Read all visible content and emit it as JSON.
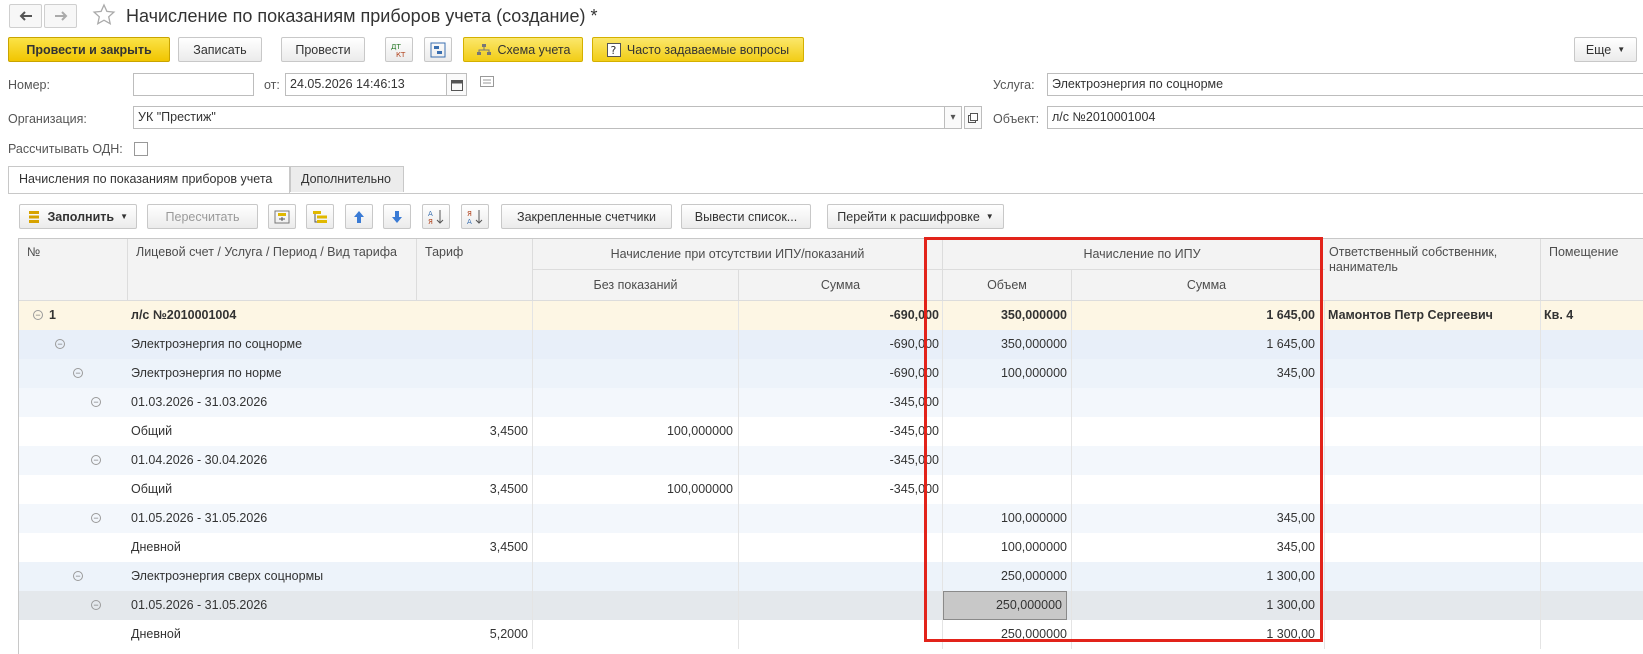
{
  "window": {
    "title": "Начисление по показаниям приборов учета (создание) *"
  },
  "toolbar": {
    "post_close": "Провести и закрыть",
    "save": "Записать",
    "post": "Провести",
    "dt_kt_icon": "dt-kt-icon",
    "structure_icon": "structure-icon",
    "schema": "Схема учета",
    "faq": "Часто задаваемые вопросы",
    "more": "Еще"
  },
  "header": {
    "number_label": "Номер:",
    "number_value": "",
    "date_label": "от:",
    "date_value": "24.05.2026 14:46:13",
    "org_label": "Организация:",
    "org_value": "УК \"Престиж\"",
    "odn_label": "Рассчитывать ОДН:",
    "odn_checked": false,
    "service_label": "Услуга:",
    "service_value": "Электроэнергия по соцнорме",
    "object_label": "Объект:",
    "object_value": "л/с №2010001004"
  },
  "tabs": [
    {
      "label": "Начисления по показаниям приборов учета",
      "active": true
    },
    {
      "label": "Дополнительно",
      "active": false
    }
  ],
  "table_toolbar": {
    "fill": "Заполнить",
    "recalc": "Пересчитать",
    "attached_meters": "Закрепленные счетчики",
    "export_list": "Вывести список...",
    "go_detail": "Перейти к расшифровке"
  },
  "table": {
    "headers": {
      "num": "№",
      "account": "Лицевой счет / Услуга / Период / Вид тарифа",
      "tariff": "Тариф",
      "no_ipu_group": "Начисление при отсутствии ИПУ/показаний",
      "no_readings": "Без показаний",
      "sum1": "Сумма",
      "ipu_group": "Начисление по ИПУ",
      "volume": "Объем",
      "sum2": "Сумма",
      "owner": "Ответственный собственник, наниматель",
      "premises": "Помещение"
    },
    "rows": [
      {
        "num": "1",
        "account": "л/с №2010001004",
        "level": 0,
        "tariff": "",
        "no_readings": "",
        "sum1": "-690,000",
        "volume": "350,000000",
        "sum2": "1 645,00",
        "owner": "Мамонтов Петр Сергеевич",
        "premises": "Кв. 4",
        "bold": true,
        "bg": "#fdf6e4",
        "tree": true
      },
      {
        "num": "",
        "account": "Электроэнергия по соцнорме",
        "level": 1,
        "tariff": "",
        "no_readings": "",
        "sum1": "-690,000",
        "volume": "350,000000",
        "sum2": "1 645,00",
        "owner": "",
        "premises": "",
        "bold": false,
        "bg": "#e8eff9",
        "tree": true
      },
      {
        "num": "",
        "account": "Электроэнергия по норме",
        "level": 2,
        "tariff": "",
        "no_readings": "",
        "sum1": "-690,000",
        "volume": "100,000000",
        "sum2": "345,00",
        "owner": "",
        "premises": "",
        "bold": false,
        "bg": "#edf3fa",
        "tree": true
      },
      {
        "num": "",
        "account": "01.03.2026 - 31.03.2026",
        "level": 3,
        "tariff": "",
        "no_readings": "",
        "sum1": "-345,000",
        "volume": "",
        "sum2": "",
        "owner": "",
        "premises": "",
        "bold": false,
        "bg": "#f3f7fc",
        "tree": true
      },
      {
        "num": "",
        "account": "Общий",
        "level": 3,
        "tariff": "3,4500",
        "no_readings": "100,000000",
        "sum1": "-345,000",
        "volume": "",
        "sum2": "",
        "owner": "",
        "premises": "",
        "bold": false,
        "bg": "#ffffff",
        "tree": false
      },
      {
        "num": "",
        "account": "01.04.2026 - 30.04.2026",
        "level": 3,
        "tariff": "",
        "no_readings": "",
        "sum1": "-345,000",
        "volume": "",
        "sum2": "",
        "owner": "",
        "premises": "",
        "bold": false,
        "bg": "#f3f7fc",
        "tree": true
      },
      {
        "num": "",
        "account": "Общий",
        "level": 3,
        "tariff": "3,4500",
        "no_readings": "100,000000",
        "sum1": "-345,000",
        "volume": "",
        "sum2": "",
        "owner": "",
        "premises": "",
        "bold": false,
        "bg": "#ffffff",
        "tree": false
      },
      {
        "num": "",
        "account": "01.05.2026 - 31.05.2026",
        "level": 3,
        "tariff": "",
        "no_readings": "",
        "sum1": "",
        "volume": "100,000000",
        "sum2": "345,00",
        "owner": "",
        "premises": "",
        "bold": false,
        "bg": "#f3f7fc",
        "tree": true
      },
      {
        "num": "",
        "account": "Дневной",
        "level": 3,
        "tariff": "3,4500",
        "no_readings": "",
        "sum1": "",
        "volume": "100,000000",
        "sum2": "345,00",
        "owner": "",
        "premises": "",
        "bold": false,
        "bg": "#ffffff",
        "tree": false
      },
      {
        "num": "",
        "account": "Электроэнергия сверх соцнормы",
        "level": 2,
        "tariff": "",
        "no_readings": "",
        "sum1": "",
        "volume": "250,000000",
        "sum2": "1 300,00",
        "owner": "",
        "premises": "",
        "bold": false,
        "bg": "#edf3fa",
        "tree": true
      },
      {
        "num": "",
        "account": "01.05.2026 - 31.05.2026",
        "level": 3,
        "tariff": "",
        "no_readings": "",
        "sum1": "",
        "volume": "250,000000",
        "sum2": "1 300,00",
        "owner": "",
        "premises": "",
        "bold": false,
        "bg": "#e4e8ec",
        "tree": true,
        "selected": true
      },
      {
        "num": "",
        "account": "Дневной",
        "level": 3,
        "tariff": "5,2000",
        "no_readings": "",
        "sum1": "",
        "volume": "250,000000",
        "sum2": "1 300,00",
        "owner": "",
        "premises": "",
        "bold": false,
        "bg": "#ffffff",
        "tree": false
      }
    ]
  },
  "colors": {
    "highlight_frame": "#e2231a",
    "primary_button": "#f1c500",
    "selected_cell": "#c8c8c8"
  }
}
